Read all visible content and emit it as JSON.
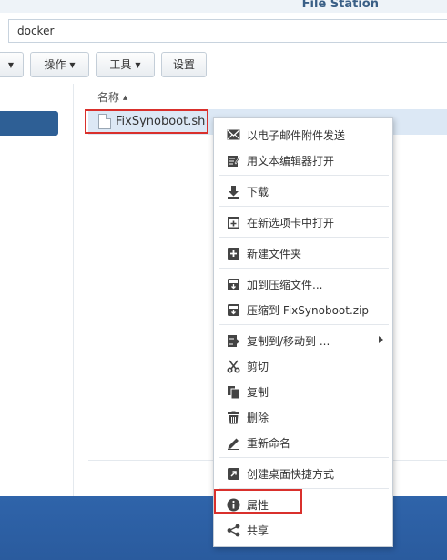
{
  "window": {
    "title": "File Station"
  },
  "path": {
    "value": "docker"
  },
  "toolbar": {
    "operate_label": "操作",
    "tools_label": "工具",
    "settings_label": "设置"
  },
  "list": {
    "column_name": "名称",
    "sort_indicator": "▲",
    "file_name": "FixSynoboot.sh"
  },
  "context_menu": {
    "items": [
      {
        "label": "以电子邮件附件发送",
        "icon": "email-icon"
      },
      {
        "label": "用文本编辑器打开",
        "icon": "edit-icon"
      },
      {
        "label": "下载",
        "icon": "download-icon"
      },
      {
        "label": "在新选项卡中打开",
        "icon": "new-tab-icon"
      },
      {
        "label": "新建文件夹",
        "icon": "new-folder-icon"
      },
      {
        "label": "加到压缩文件...",
        "icon": "archive-add-icon"
      },
      {
        "label": "压缩到 FixSynoboot.zip",
        "icon": "archive-icon"
      },
      {
        "label": "复制到/移动到 ...",
        "icon": "copy-move-icon"
      },
      {
        "label": "剪切",
        "icon": "scissors-icon"
      },
      {
        "label": "复制",
        "icon": "copy-icon"
      },
      {
        "label": "删除",
        "icon": "trash-icon"
      },
      {
        "label": "重新命名",
        "icon": "pencil-icon"
      },
      {
        "label": "创建桌面快捷方式",
        "icon": "shortcut-icon"
      },
      {
        "label": "属性",
        "icon": "info-icon"
      },
      {
        "label": "共享",
        "icon": "share-icon"
      }
    ]
  },
  "colors": {
    "highlight_box": "#d9302c",
    "selection": "#dce8f5",
    "sidebar_selected": "#2e5f95",
    "desktop": "#2b5ea3"
  }
}
